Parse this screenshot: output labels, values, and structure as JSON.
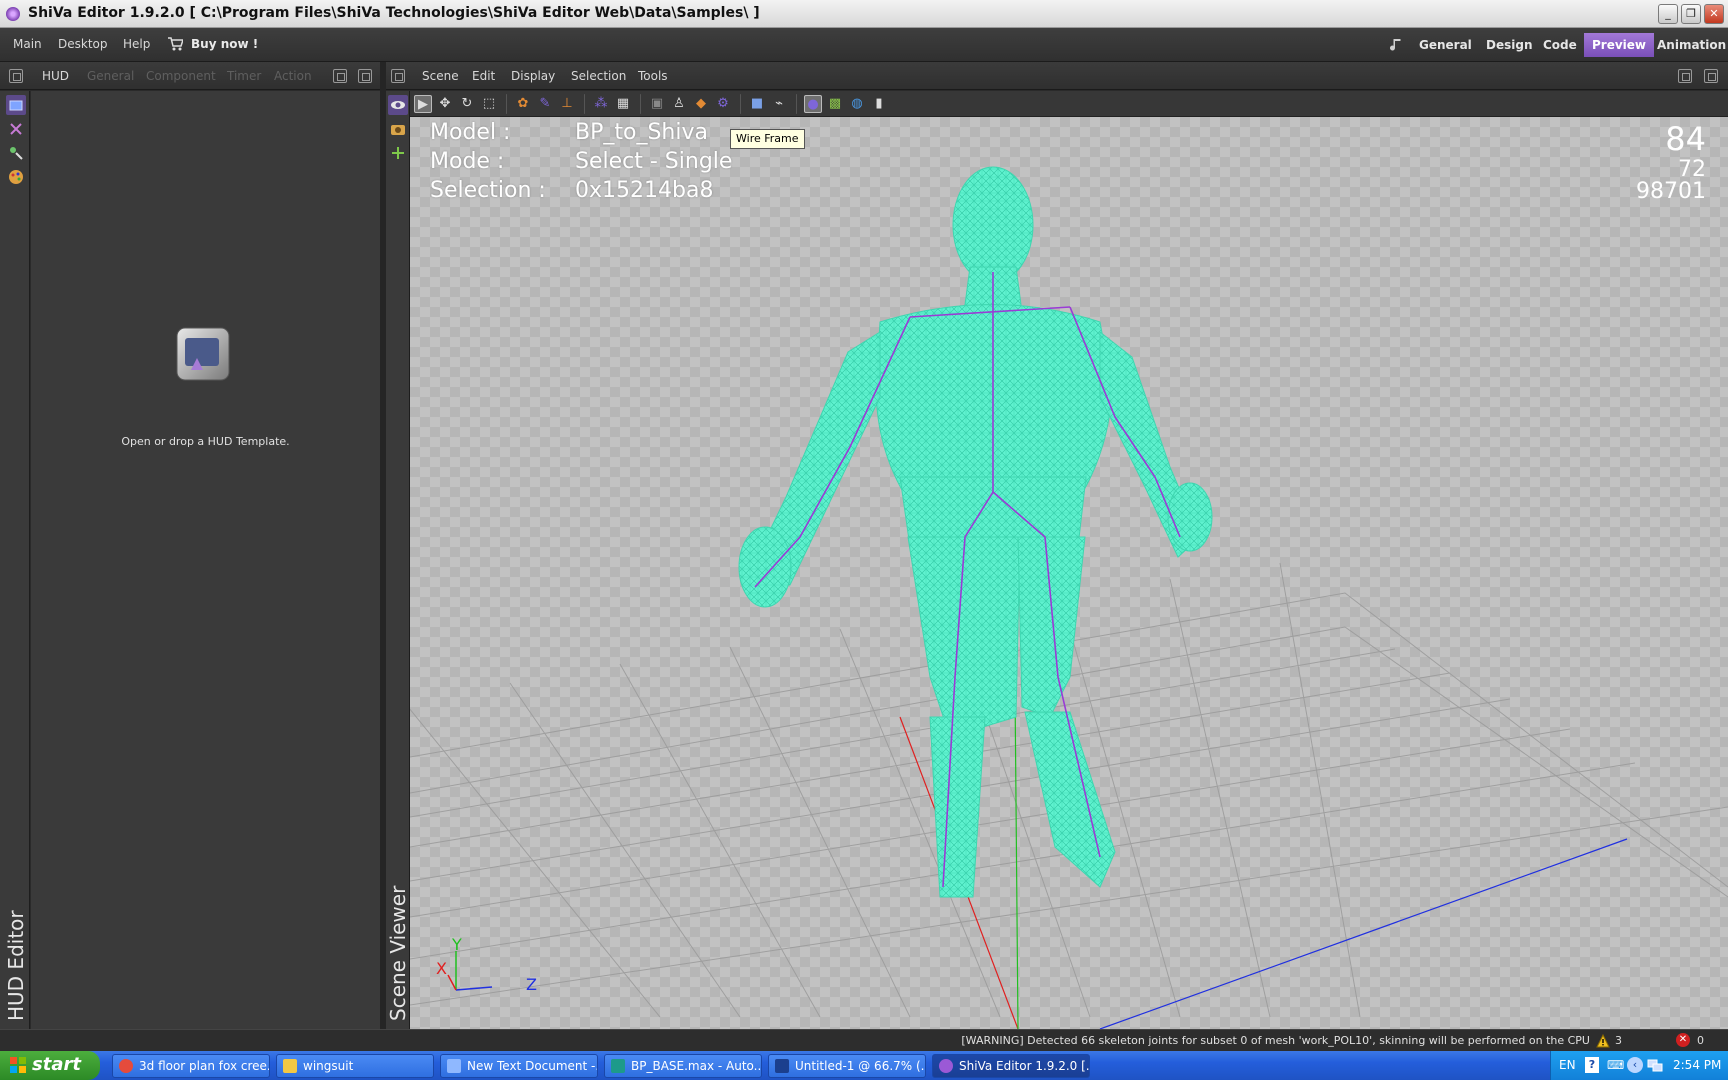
{
  "window": {
    "title": "ShiVa Editor 1.9.2.0 [ C:\\Program Files\\ShiVa Technologies\\ShiVa Editor Web\\Data\\Samples\\ ]",
    "controls": {
      "minimize": "_",
      "restore": "❐",
      "close": "✕"
    }
  },
  "menubar": {
    "items": [
      "Main",
      "Desktop",
      "Help"
    ],
    "buy_now": "Buy now !",
    "modes": [
      "General",
      "Design",
      "Code",
      "Preview",
      "Animation"
    ],
    "active_mode": "Preview"
  },
  "hud_panel": {
    "tabs": [
      "HUD",
      "General",
      "Component",
      "Timer",
      "Action"
    ],
    "message": "Open or drop a HUD Template.",
    "side_label": "HUD Editor"
  },
  "scene_panel": {
    "menus": [
      "Scene",
      "Edit",
      "Display",
      "Selection",
      "Tools"
    ],
    "side_label": "Scene Viewer",
    "tooltip": "Wire Frame"
  },
  "viewport": {
    "info": [
      {
        "label": "Model :",
        "value": "BP_to_Shiva"
      },
      {
        "label": "Mode :",
        "value": "Select - Single"
      },
      {
        "label": "Selection :",
        "value": "0x15214ba8"
      }
    ],
    "stats": {
      "fps": "84",
      "line2": "72",
      "line3": "98701"
    },
    "axes": {
      "y": "Y",
      "x": "X",
      "z": "Z"
    },
    "colors": {
      "wire": "#5ff2cf",
      "skeleton": "#9a3bd6",
      "axis_x": "#e02020",
      "axis_y": "#20c020",
      "axis_z": "#2030e0"
    }
  },
  "statusbar": {
    "warning": "[WARNING] Detected 66 skeleton joints for subset 0 of mesh 'work_POL10', skinning will be performed on the CPU",
    "warnings_count": "3",
    "errors_count": "0"
  },
  "taskbar": {
    "start": "start",
    "tasks": [
      {
        "label": "3d floor plan fox cree...",
        "icon_color": "#e54b3c",
        "active": false
      },
      {
        "label": "wingsuit",
        "icon_color": "#f2c744",
        "active": false
      },
      {
        "label": "New Text Document -...",
        "icon_color": "#8fb8ff",
        "active": false
      },
      {
        "label": "BP_BASE.max - Auto...",
        "icon_color": "#1d9a8a",
        "active": false
      },
      {
        "label": "Untitled-1 @ 66.7% (...",
        "icon_color": "#1b3f8e",
        "active": false
      },
      {
        "label": "ShiVa Editor 1.9.2.0 [...",
        "icon_color": "#9b59d6",
        "active": true
      }
    ],
    "lang": "EN",
    "time": "2:54 PM"
  }
}
